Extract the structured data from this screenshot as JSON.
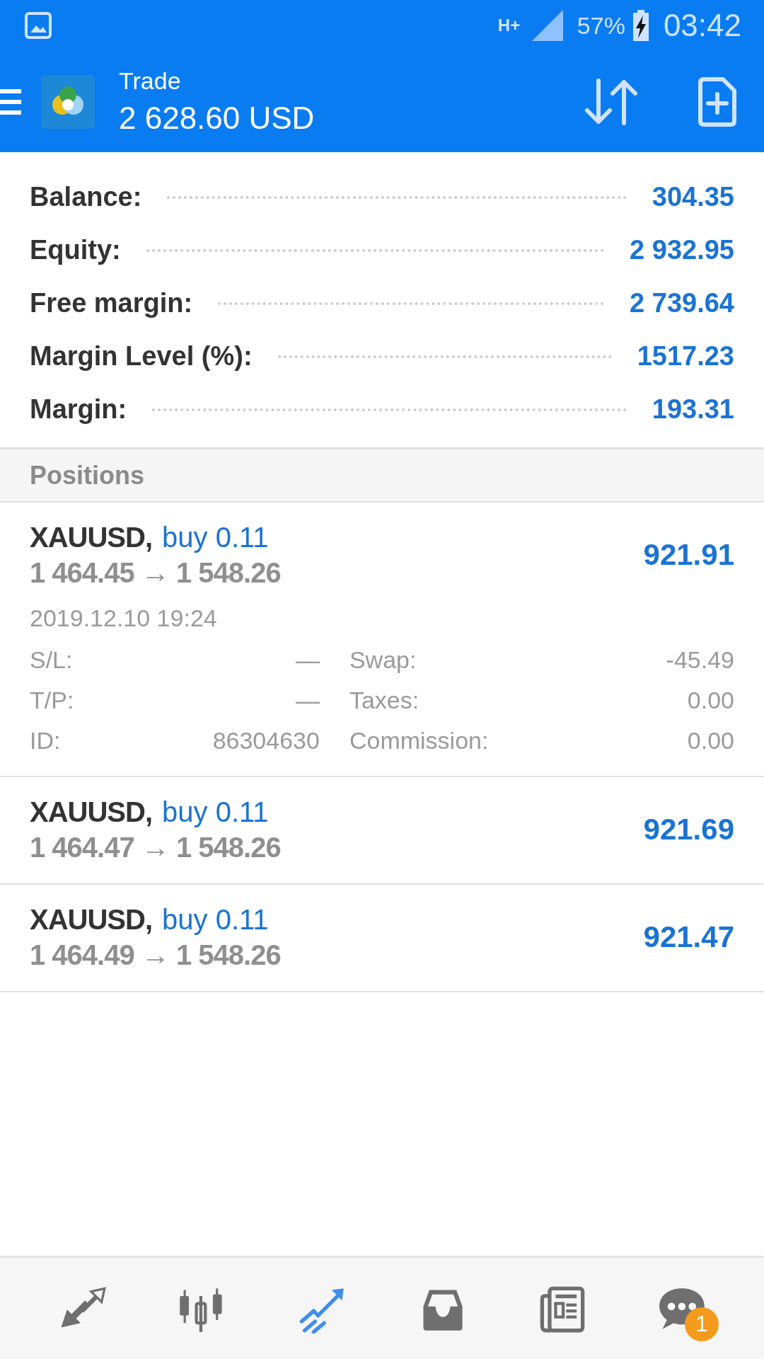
{
  "status_bar": {
    "network": "H+",
    "battery": "57%",
    "time": "03:42"
  },
  "app_bar": {
    "title": "Trade",
    "balance": "2 628.60 USD"
  },
  "summary": [
    {
      "label": "Balance:",
      "value": "304.35"
    },
    {
      "label": "Equity:",
      "value": "2 932.95"
    },
    {
      "label": "Free margin:",
      "value": "2 739.64"
    },
    {
      "label": "Margin Level (%):",
      "value": "1517.23"
    },
    {
      "label": "Margin:",
      "value": "193.31"
    }
  ],
  "positions_header": "Positions",
  "positions": [
    {
      "symbol": "XAUUSD,",
      "side": "buy 0.11",
      "prices": "1 464.45 → 1 548.26",
      "profit": "921.91",
      "expanded": true,
      "time": "2019.12.10 19:24",
      "details": [
        {
          "label": "S/L:",
          "value": "—",
          "label_2": "Swap:",
          "value_2": "-45.49"
        },
        {
          "label": "T/P:",
          "value": "—",
          "label_2": "Taxes:",
          "value_2": "0.00"
        },
        {
          "label": "ID:",
          "value": "86304630",
          "label_2": "Commission:",
          "value_2": "0.00"
        }
      ]
    },
    {
      "symbol": "XAUUSD,",
      "side": "buy 0.11",
      "prices": "1 464.47 → 1 548.26",
      "profit": "921.69",
      "expanded": false
    },
    {
      "symbol": "XAUUSD,",
      "side": "buy 0.11",
      "prices": "1 464.49 → 1 548.26",
      "profit": "921.47",
      "expanded": false
    }
  ],
  "bottom_nav": [
    {
      "kind": "quotes",
      "selected": false
    },
    {
      "kind": "chart",
      "selected": false
    },
    {
      "kind": "trade",
      "selected": true
    },
    {
      "kind": "history",
      "selected": false
    },
    {
      "kind": "news",
      "selected": false
    },
    {
      "kind": "chat",
      "selected": false,
      "badge": "1"
    }
  ]
}
